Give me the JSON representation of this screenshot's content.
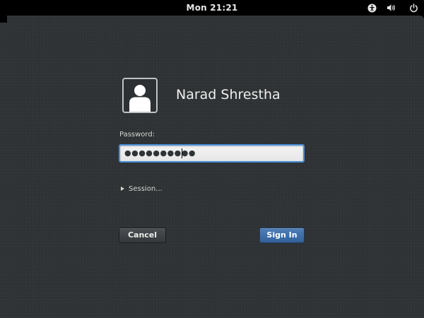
{
  "topbar": {
    "clock": "Mon 21:21",
    "icons": {
      "accessibility": "accessibility-icon",
      "volume": "volume-icon",
      "power": "power-icon"
    }
  },
  "login": {
    "user_name": "Narad Shrestha",
    "password_label": "Password:",
    "password_masked": "●●●●●●●●●●",
    "session_label": "Session...",
    "cancel_label": "Cancel",
    "signin_label": "Sign In"
  },
  "colors": {
    "background": "#2f3336",
    "topbar": "#000000",
    "focus_border": "#4a90d9",
    "signin_button": "#3b6ea8",
    "cancel_button": "#3d4144"
  }
}
